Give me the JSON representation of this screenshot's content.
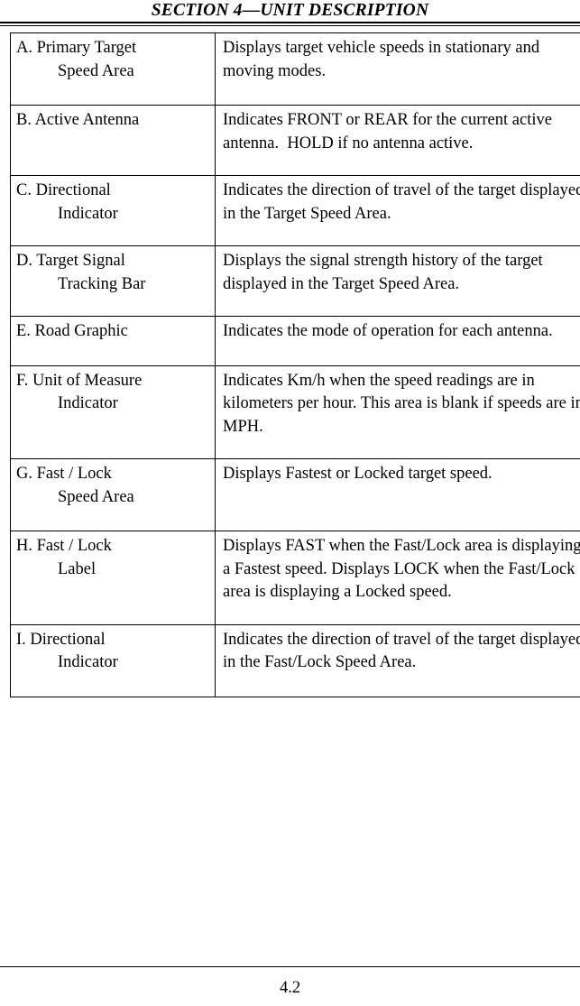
{
  "header": {
    "title": "SECTION 4—UNIT DESCRIPTION"
  },
  "table": {
    "rows": [
      {
        "key": "A",
        "label": "A. Primary Target\nSpeed Area",
        "description": "Displays target vehicle speeds in stationary and moving modes."
      },
      {
        "key": "B",
        "label": "B. Active Antenna",
        "description": "Indicates FRONT or REAR for the current active antenna.  HOLD if no antenna active."
      },
      {
        "key": "C",
        "label": "C. Directional\nIndicator",
        "description": "Indicates the direction of travel of the target displayed in the Target Speed Area."
      },
      {
        "key": "D",
        "label": "D. Target Signal\nTracking Bar",
        "description": "Displays the signal strength history of the target displayed in the Target Speed Area."
      },
      {
        "key": "E",
        "label": "E. Road Graphic",
        "description": "Indicates the mode of operation for each antenna."
      },
      {
        "key": "F",
        "label": "F. Unit of Measure\nIndicator",
        "description": "Indicates Km/h when the speed readings are in kilometers per hour. This area is blank if speeds are in MPH."
      },
      {
        "key": "G",
        "label": "G. Fast / Lock\nSpeed Area",
        "description": "Displays Fastest or Locked target speed."
      },
      {
        "key": "H",
        "label": "H. Fast / Lock\nLabel",
        "description": "Displays FAST when the Fast/Lock area is displaying a Fastest speed. Displays LOCK when the Fast/Lock area is displaying a Locked speed."
      },
      {
        "key": "I",
        "label": "I. Directional\nIndicator",
        "description": "Indicates the direction of travel of the target displayed in the Fast/Lock Speed Area."
      }
    ]
  },
  "footer": {
    "page_number": "4.2"
  }
}
